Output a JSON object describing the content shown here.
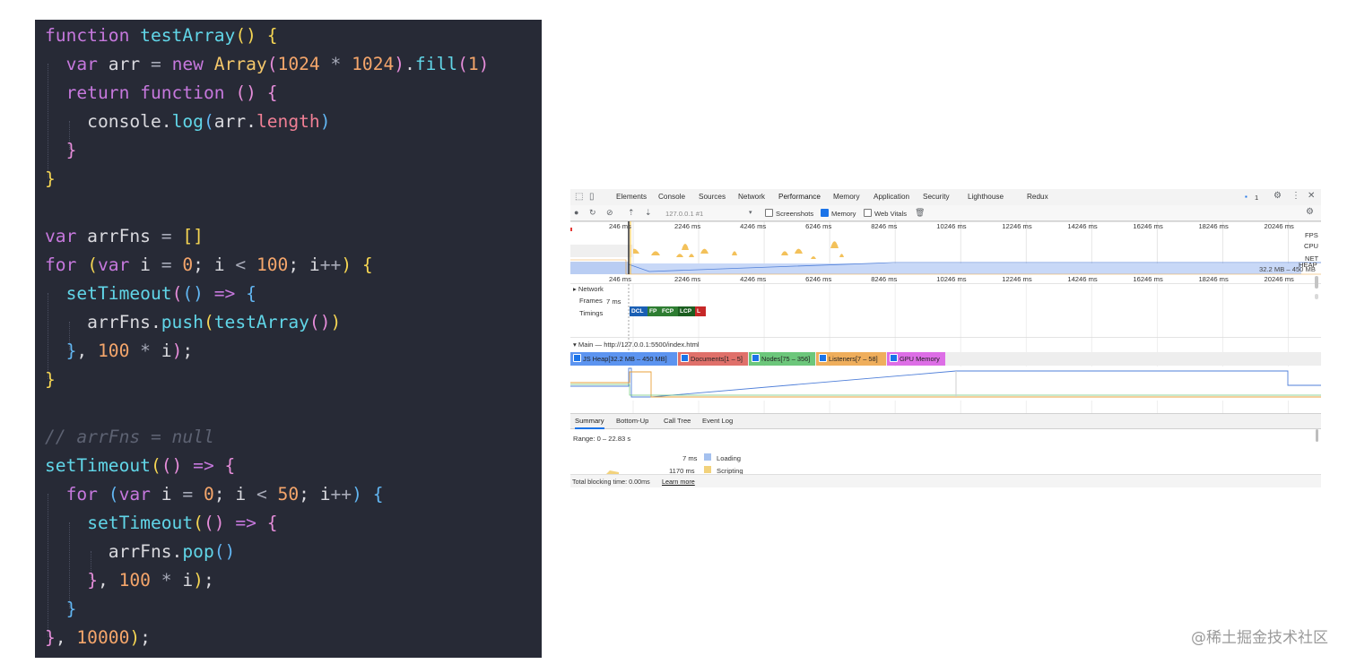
{
  "code_lines": [
    [
      {
        "t": "function",
        "c": "kw"
      },
      {
        "t": " ",
        "c": "id"
      },
      {
        "t": "testArray",
        "c": "fn"
      },
      {
        "t": "() {",
        "c": "br1"
      }
    ],
    [
      {
        "t": "  ",
        "c": "id"
      },
      {
        "t": "var",
        "c": "kw"
      },
      {
        "t": " arr ",
        "c": "id"
      },
      {
        "t": "=",
        "c": "op"
      },
      {
        "t": " ",
        "c": "id"
      },
      {
        "t": "new",
        "c": "kw"
      },
      {
        "t": " ",
        "c": "id"
      },
      {
        "t": "Array",
        "c": "cls"
      },
      {
        "t": "(",
        "c": "br2"
      },
      {
        "t": "1024",
        "c": "num"
      },
      {
        "t": " * ",
        "c": "op"
      },
      {
        "t": "1024",
        "c": "num"
      },
      {
        "t": ")",
        "c": "br2"
      },
      {
        "t": ".",
        "c": "id"
      },
      {
        "t": "fill",
        "c": "fn"
      },
      {
        "t": "(",
        "c": "br2"
      },
      {
        "t": "1",
        "c": "num"
      },
      {
        "t": ")",
        "c": "br2"
      }
    ],
    [
      {
        "t": "  ",
        "c": "id"
      },
      {
        "t": "return",
        "c": "kw"
      },
      {
        "t": " ",
        "c": "id"
      },
      {
        "t": "function",
        "c": "kw"
      },
      {
        "t": " ",
        "c": "id"
      },
      {
        "t": "() {",
        "c": "br2"
      }
    ],
    [
      {
        "t": "    console.",
        "c": "id"
      },
      {
        "t": "log",
        "c": "fn"
      },
      {
        "t": "(",
        "c": "br3"
      },
      {
        "t": "arr.",
        "c": "id"
      },
      {
        "t": "length",
        "c": "prop"
      },
      {
        "t": ")",
        "c": "br3"
      }
    ],
    [
      {
        "t": "  ",
        "c": "id"
      },
      {
        "t": "}",
        "c": "br2"
      }
    ],
    [
      {
        "t": "}",
        "c": "br1"
      }
    ],
    [],
    [
      {
        "t": "var",
        "c": "kw"
      },
      {
        "t": " arrFns ",
        "c": "id"
      },
      {
        "t": "=",
        "c": "op"
      },
      {
        "t": " ",
        "c": "id"
      },
      {
        "t": "[]",
        "c": "br1"
      }
    ],
    [
      {
        "t": "for",
        "c": "kw"
      },
      {
        "t": " ",
        "c": "id"
      },
      {
        "t": "(",
        "c": "br1"
      },
      {
        "t": "var",
        "c": "kw"
      },
      {
        "t": " i ",
        "c": "id"
      },
      {
        "t": "=",
        "c": "op"
      },
      {
        "t": " ",
        "c": "id"
      },
      {
        "t": "0",
        "c": "num"
      },
      {
        "t": "; i ",
        "c": "id"
      },
      {
        "t": "<",
        "c": "op"
      },
      {
        "t": " ",
        "c": "id"
      },
      {
        "t": "100",
        "c": "num"
      },
      {
        "t": "; i",
        "c": "id"
      },
      {
        "t": "++",
        "c": "op"
      },
      {
        "t": ")",
        "c": "br1"
      },
      {
        "t": " ",
        "c": "id"
      },
      {
        "t": "{",
        "c": "br1"
      }
    ],
    [
      {
        "t": "  ",
        "c": "id"
      },
      {
        "t": "setTimeout",
        "c": "fn"
      },
      {
        "t": "(",
        "c": "br2"
      },
      {
        "t": "()",
        "c": "br3"
      },
      {
        "t": " => ",
        "c": "kw"
      },
      {
        "t": "{",
        "c": "br3"
      }
    ],
    [
      {
        "t": "    arrFns.",
        "c": "id"
      },
      {
        "t": "push",
        "c": "fn"
      },
      {
        "t": "(",
        "c": "br1"
      },
      {
        "t": "testArray",
        "c": "fn"
      },
      {
        "t": "()",
        "c": "br2"
      },
      {
        "t": ")",
        "c": "br1"
      }
    ],
    [
      {
        "t": "  ",
        "c": "id"
      },
      {
        "t": "}",
        "c": "br3"
      },
      {
        "t": ", ",
        "c": "id"
      },
      {
        "t": "100",
        "c": "num"
      },
      {
        "t": " * ",
        "c": "op"
      },
      {
        "t": "i",
        "c": "id"
      },
      {
        "t": ")",
        "c": "br2"
      },
      {
        "t": ";",
        "c": "id"
      }
    ],
    [
      {
        "t": "}",
        "c": "br1"
      }
    ],
    [],
    [
      {
        "t": "// arrFns = null",
        "c": "cmt"
      }
    ],
    [
      {
        "t": "setTimeout",
        "c": "fn"
      },
      {
        "t": "(",
        "c": "br1"
      },
      {
        "t": "()",
        "c": "br2"
      },
      {
        "t": " => ",
        "c": "kw"
      },
      {
        "t": "{",
        "c": "br2"
      }
    ],
    [
      {
        "t": "  ",
        "c": "id"
      },
      {
        "t": "for",
        "c": "kw"
      },
      {
        "t": " ",
        "c": "id"
      },
      {
        "t": "(",
        "c": "br3"
      },
      {
        "t": "var",
        "c": "kw"
      },
      {
        "t": " i ",
        "c": "id"
      },
      {
        "t": "=",
        "c": "op"
      },
      {
        "t": " ",
        "c": "id"
      },
      {
        "t": "0",
        "c": "num"
      },
      {
        "t": "; i ",
        "c": "id"
      },
      {
        "t": "<",
        "c": "op"
      },
      {
        "t": " ",
        "c": "id"
      },
      {
        "t": "50",
        "c": "num"
      },
      {
        "t": "; i",
        "c": "id"
      },
      {
        "t": "++",
        "c": "op"
      },
      {
        "t": ")",
        "c": "br3"
      },
      {
        "t": " ",
        "c": "id"
      },
      {
        "t": "{",
        "c": "br3"
      }
    ],
    [
      {
        "t": "    ",
        "c": "id"
      },
      {
        "t": "setTimeout",
        "c": "fn"
      },
      {
        "t": "(",
        "c": "br1"
      },
      {
        "t": "()",
        "c": "br2"
      },
      {
        "t": " => ",
        "c": "kw"
      },
      {
        "t": "{",
        "c": "br2"
      }
    ],
    [
      {
        "t": "      arrFns.",
        "c": "id"
      },
      {
        "t": "pop",
        "c": "fn"
      },
      {
        "t": "()",
        "c": "br3"
      }
    ],
    [
      {
        "t": "    ",
        "c": "id"
      },
      {
        "t": "}",
        "c": "br2"
      },
      {
        "t": ", ",
        "c": "id"
      },
      {
        "t": "100",
        "c": "num"
      },
      {
        "t": " * ",
        "c": "op"
      },
      {
        "t": "i",
        "c": "id"
      },
      {
        "t": ")",
        "c": "br1"
      },
      {
        "t": ";",
        "c": "id"
      }
    ],
    [
      {
        "t": "  ",
        "c": "id"
      },
      {
        "t": "}",
        "c": "br3"
      }
    ],
    [
      {
        "t": "}",
        "c": "br2"
      },
      {
        "t": ", ",
        "c": "id"
      },
      {
        "t": "10000",
        "c": "num"
      },
      {
        "t": ")",
        "c": "br1"
      },
      {
        "t": ";",
        "c": "id"
      }
    ]
  ],
  "devtools": {
    "tabs": [
      "Elements",
      "Console",
      "Sources",
      "Network",
      "Performance",
      "Memory",
      "Application",
      "Security",
      "Lighthouse",
      "Redux"
    ],
    "active_tab": "Performance",
    "issues_count": "1",
    "url_select": "127.0.0.1 #1",
    "screenshots_label": "Screenshots",
    "memory_label": "Memory",
    "web_vitals_label": "Web Vitals",
    "screenshots_checked": false,
    "memory_checked": true,
    "web_vitals_checked": false,
    "ticks": [
      "246 ms",
      "2246 ms",
      "4246 ms",
      "6246 ms",
      "8246 ms",
      "10246 ms",
      "12246 ms",
      "14246 ms",
      "16246 ms",
      "18246 ms",
      "20246 ms"
    ],
    "overview_labels": {
      "fps": "FPS",
      "cpu": "CPU",
      "net": "NET",
      "heap": "HEAP"
    },
    "heap_range": "32.2 MB – 450 MB",
    "tracks": {
      "network": "Network",
      "frames": "Frames",
      "frames_value": "7 ms",
      "timings": "Timings"
    },
    "timing_badges": [
      {
        "label": "DCL",
        "color": "#1a5fb4"
      },
      {
        "label": "FP",
        "color": "#2e7d32"
      },
      {
        "label": "FCP",
        "color": "#2e7d32"
      },
      {
        "label": "LCP",
        "color": "#1b5e20"
      },
      {
        "label": "L",
        "color": "#c62828"
      }
    ],
    "main_thread": "Main — http://127.0.0.1:5500/index.html",
    "counters": [
      {
        "label": "JS Heap[32.2 MB – 450 MB]",
        "color": "#5c94f0"
      },
      {
        "label": "Documents[1 – 5]",
        "color": "#e0706a"
      },
      {
        "label": "Nodes[75 – 356]",
        "color": "#6cc77b"
      },
      {
        "label": "Listeners[7 – 58]",
        "color": "#efae5c"
      },
      {
        "label": "GPU Memory",
        "color": "#dd6ee6"
      }
    ],
    "bottom_tabs": [
      "Summary",
      "Bottom-Up",
      "Call Tree",
      "Event Log"
    ],
    "bottom_active": "Summary",
    "range": "Range: 0 – 22.83 s",
    "summary": [
      {
        "time": "7 ms",
        "label": "Loading",
        "color": "#a5c1ef"
      },
      {
        "time": "1170 ms",
        "label": "Scripting",
        "color": "#f2d27c"
      }
    ],
    "blocking_time": "Total blocking time: 0.00ms",
    "learn_more": "Learn more"
  },
  "watermark": "@稀土掘金技术社区"
}
